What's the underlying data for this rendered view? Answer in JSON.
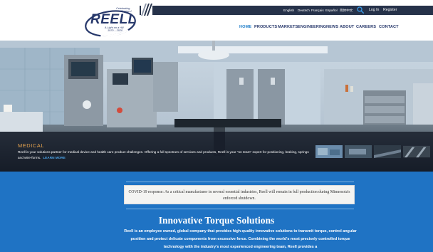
{
  "header": {
    "logo": {
      "tag_top": "Celebrating",
      "tag_top2": "50 years!",
      "wordmark": "REELL",
      "tag_mid": "A Light on a Hill",
      "tag_years": "1970 – 2020"
    },
    "languages": [
      "English",
      "Deutsch",
      "Français",
      "Español",
      "简体中文"
    ],
    "search_icon": "search-icon",
    "login_label": "Log In",
    "register_label": "Register",
    "nav": [
      "HOME",
      "PRODUCTS",
      "MARKETS",
      "ENGINEERING",
      "NEWS",
      "ABOUT",
      "CAREERS",
      "CONTACT"
    ],
    "active_nav": "HOME"
  },
  "hero": {
    "title": "MEDICAL",
    "text": "Reell is your solutions partner for medical device and health care product challenges. Offering a full spectrum of services and products, Reell is your \"on team\" expert for positioning, braking, springs and wire-forms.",
    "link_label": "LEARN MORE"
  },
  "covid": {
    "text": "COVID-19 response: As a critical manufacturer in several essential industries, Reell will remain in full production during Minnesota's enforced shutdown."
  },
  "promo": {
    "title": "Innovative Torque Solutions",
    "body": "Reell is an employee owned, global company that provides high-quality innovative solutions to transmit torque, control angular position and protect delicate components from excessive force. Combining the world's most precisely controlled torque technology with the industry's most experienced engineering team, Reell provides a"
  },
  "colors": {
    "navy": "#26324a",
    "brand_blue": "#27386b",
    "accent_blue": "#1c7cc8",
    "promo_blue": "#1f73c4",
    "caption_orange": "#e3a24e"
  }
}
